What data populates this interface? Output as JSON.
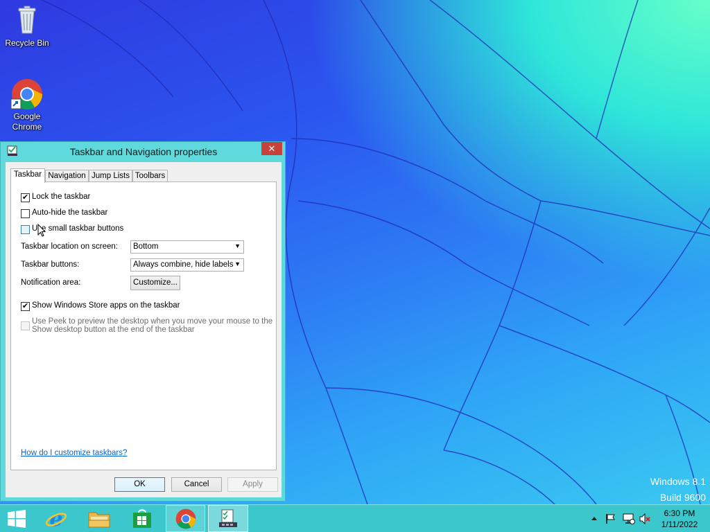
{
  "desktop": {
    "icons": [
      {
        "label": "Recycle Bin",
        "icon": "recycle-bin-icon"
      },
      {
        "label": "Google Chrome",
        "label_line1": "Google",
        "label_line2": "Chrome",
        "icon": "chrome-icon"
      }
    ],
    "watermark": {
      "line1": "Windows 8.1",
      "line2": "Build 9600"
    }
  },
  "dialog": {
    "title": "Taskbar and Navigation properties",
    "close_label": "✕",
    "tabs": [
      {
        "label": "Taskbar",
        "active": true
      },
      {
        "label": "Navigation",
        "active": false
      },
      {
        "label": "Jump Lists",
        "active": false
      },
      {
        "label": "Toolbars",
        "active": false
      }
    ],
    "options": {
      "lock_taskbar": {
        "label": "Lock the taskbar",
        "checked": true
      },
      "auto_hide": {
        "label": "Auto-hide the taskbar",
        "checked": false
      },
      "small_buttons": {
        "label": "Use small taskbar buttons",
        "checked": false
      },
      "store_apps": {
        "label": "Show Windows Store apps on the taskbar",
        "checked": true
      },
      "peek": {
        "line1": "Use Peek to preview the desktop when you move your mouse to the",
        "line2": "Show desktop button at the end of the taskbar",
        "checked": false,
        "disabled": true
      }
    },
    "location": {
      "label": "Taskbar location on screen:",
      "value": "Bottom"
    },
    "buttons_setting": {
      "label": "Taskbar buttons:",
      "value": "Always combine, hide labels"
    },
    "notification": {
      "label": "Notification area:",
      "button": "Customize..."
    },
    "help_link": "How do I customize taskbars?",
    "footer": {
      "ok": "OK",
      "cancel": "Cancel",
      "apply": "Apply"
    }
  },
  "taskbar": {
    "items": [
      {
        "name": "start-button",
        "icon": "windows-logo-icon"
      },
      {
        "name": "internet-explorer",
        "icon": "ie-icon"
      },
      {
        "name": "file-explorer",
        "icon": "folder-icon"
      },
      {
        "name": "windows-store",
        "icon": "store-icon"
      },
      {
        "name": "google-chrome",
        "icon": "chrome-icon",
        "running": true
      },
      {
        "name": "taskbar-properties",
        "icon": "taskbar-properties-icon",
        "active": true
      }
    ],
    "tray": [
      "show-hidden-icons",
      "action-center-flag-icon",
      "network-icon",
      "volume-muted-icon"
    ],
    "clock": {
      "time": "6:30 PM",
      "date": "1/11/2022"
    }
  }
}
